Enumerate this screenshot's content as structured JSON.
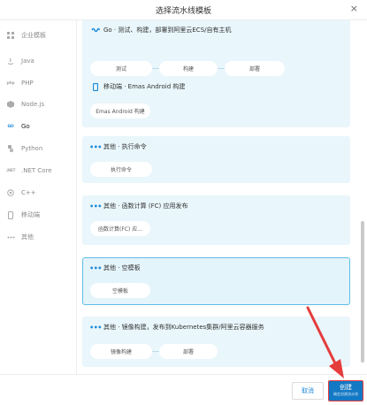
{
  "dialog": {
    "title": "选择流水线模板",
    "close_glyph": "×"
  },
  "sidebar": {
    "items": [
      {
        "label": "企业模板",
        "icon": "grid-icon",
        "active": false
      },
      {
        "label": "Java",
        "icon": "java-icon",
        "active": false
      },
      {
        "label": "PHP",
        "icon": "php-icon",
        "active": false
      },
      {
        "label": "Node.js",
        "icon": "nodejs-icon",
        "active": false
      },
      {
        "label": "Go",
        "icon": "go-icon",
        "active": true
      },
      {
        "label": "Python",
        "icon": "python-icon",
        "active": false
      },
      {
        "label": ".NET Core",
        "icon": "dotnet-icon",
        "active": false
      },
      {
        "label": "C++",
        "icon": "cpp-icon",
        "active": false
      },
      {
        "label": "移动端",
        "icon": "mobile-icon",
        "active": false
      },
      {
        "label": "其他",
        "icon": "more-icon",
        "active": false
      }
    ],
    "icon_text": {
      "php": "php",
      "go": "GO",
      "dotnet": ".NET"
    }
  },
  "templates": [
    {
      "title": "Go · 测试、构建，部署到阿里云ECS/自有主机",
      "steps": [
        "测试",
        "构建",
        "部署"
      ],
      "icon": "go-icon"
    },
    {
      "title": "移动端 · Emas Android 构建",
      "steps": [
        "Emas Android 构建"
      ],
      "icon": "mobile-icon"
    },
    {
      "title": "其他 · 执行命令",
      "steps": [
        "执行命令"
      ],
      "icon": "more-icon"
    },
    {
      "title": "其他 · 函数计算 (FC) 应用发布",
      "steps": [
        "函数计算(FC) 应..."
      ],
      "icon": "more-icon"
    },
    {
      "title": "其他 · 空模板",
      "steps": [
        "空模板"
      ],
      "icon": "more-icon",
      "selected": true
    },
    {
      "title": "其他 · 镜像构建，发布到Kubernetes集群/阿里云容器服务",
      "steps": [
        "镜像构建",
        "部署"
      ],
      "icon": "more-icon"
    }
  ],
  "footer": {
    "cancel_label": "取消",
    "create_label": "创建",
    "create_sub": "确定创建流水线"
  },
  "colors": {
    "accent": "#1d8ad8",
    "card_bg": "#e9f6fb",
    "selected_border": "#5fbde6",
    "annotation_red": "#e53c3c"
  }
}
